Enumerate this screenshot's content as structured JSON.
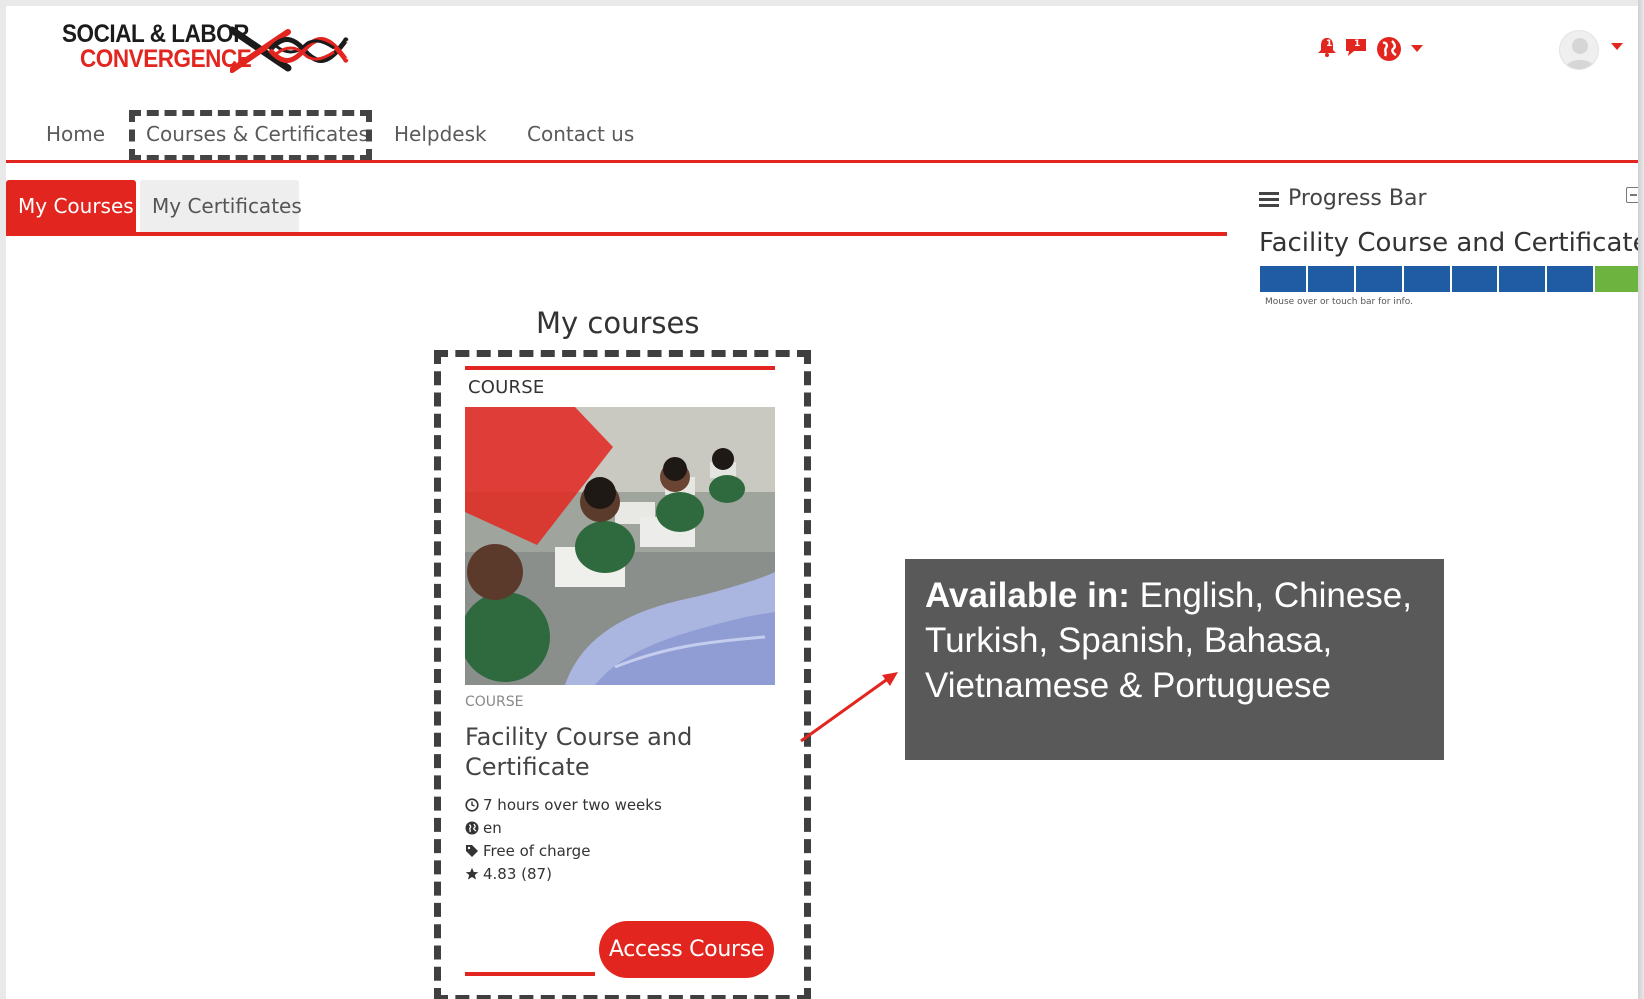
{
  "logo": {
    "line1": "SOCIAL & LABOR",
    "line2": "CONVERGENCE"
  },
  "header": {
    "notifications_count": "1",
    "messages_count": "1"
  },
  "nav": {
    "items": [
      {
        "label": "Home"
      },
      {
        "label": "Courses & Certificates"
      },
      {
        "label": "Helpdesk"
      },
      {
        "label": "Contact us"
      }
    ]
  },
  "tabs": [
    {
      "label": "My Courses",
      "active": true
    },
    {
      "label": "My Certificates",
      "active": false
    }
  ],
  "main": {
    "heading": "My courses",
    "card": {
      "category_top": "COURSE",
      "category": "COURSE",
      "title": "Facility Course and Certificate",
      "duration": "7 hours over two weeks",
      "language": "en",
      "price": "Free of charge",
      "rating": "4.83 (87)",
      "button": "Access Course"
    }
  },
  "progress": {
    "title": "Progress Bar",
    "course": "Facility Course and Certificate",
    "segments": [
      "done",
      "done",
      "done",
      "done",
      "done",
      "done",
      "done",
      "current"
    ],
    "note": "Mouse over or touch bar for info."
  },
  "callout": {
    "label": "Available in:",
    "text": "English, Chinese, Turkish, Spanish, Bahasa, Vietnamese & Portuguese"
  },
  "colors": {
    "brand_red": "#e2261f",
    "progress_done": "#1f5ca3",
    "progress_current": "#6cb33f",
    "callout_bg": "#595959"
  }
}
